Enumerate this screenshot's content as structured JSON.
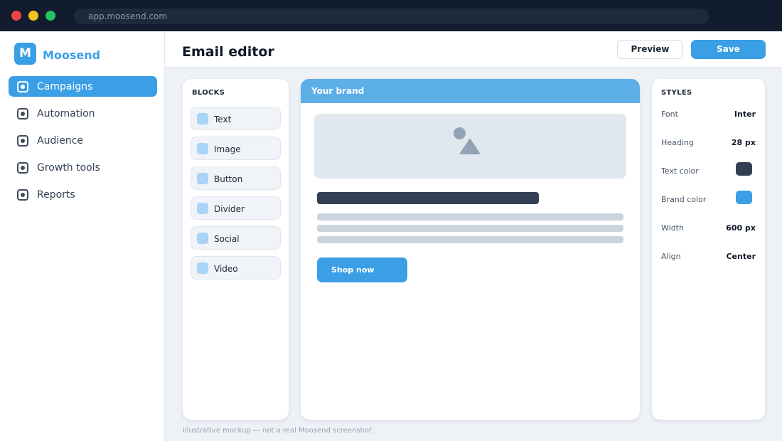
{
  "browser": {
    "url": "app.moosend.com"
  },
  "sidebar": {
    "logo_letter": "M",
    "brand": "Moosend",
    "items": [
      {
        "label": "Campaigns",
        "active": true
      },
      {
        "label": "Automation",
        "active": false
      },
      {
        "label": "Audience",
        "active": false
      },
      {
        "label": "Growth tools",
        "active": false
      },
      {
        "label": "Reports",
        "active": false
      }
    ]
  },
  "header": {
    "title": "Email editor",
    "preview_label": "Preview",
    "save_label": "Save"
  },
  "blocks": {
    "heading": "BLOCKS",
    "items": [
      "Text",
      "Image",
      "Button",
      "Divider",
      "Social",
      "Video"
    ]
  },
  "canvas": {
    "brand_label": "Your brand",
    "image_icon": "image-placeholder-icon",
    "cta_label": "Shop now"
  },
  "styles": {
    "heading": "STYLES",
    "rows": [
      {
        "label": "Font",
        "value": "Inter"
      },
      {
        "label": "Heading",
        "value": "28 px"
      },
      {
        "label": "Text color",
        "color": "#333f52"
      },
      {
        "label": "Brand color",
        "color": "#3b9fe5"
      },
      {
        "label": "Width",
        "value": "600 px"
      },
      {
        "label": "Align",
        "value": "Center"
      }
    ]
  },
  "footnote": "Illustrative mockup — not a real Moosend screenshot",
  "colors": {
    "accent": "#3b9fe5",
    "brand_bar": "#5caee7",
    "chrome": "#111c2e"
  }
}
